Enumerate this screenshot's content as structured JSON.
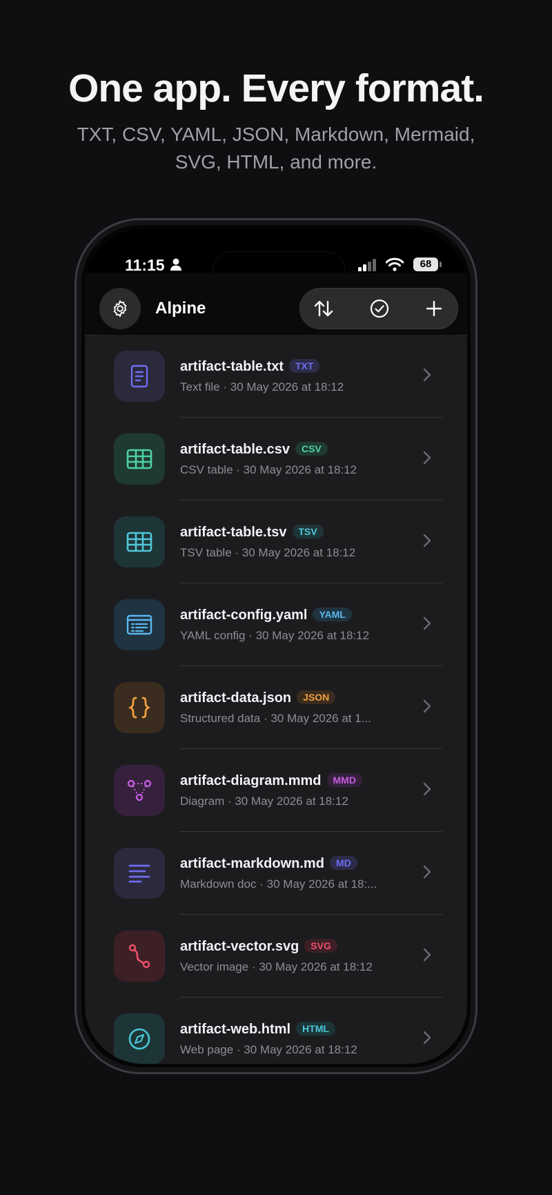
{
  "hero": {
    "headline": "One app. Every format.",
    "subline": "TXT, CSV, YAML, JSON, Markdown, Mermaid, SVG, HTML, and more."
  },
  "status": {
    "time": "11:15",
    "battery": "68"
  },
  "nav": {
    "title": "Alpine"
  },
  "files": [
    {
      "name": "artifact-table.txt",
      "badge": "TXT",
      "meta": "Text file · 30 May 2026 at 18:12",
      "icon": "document-icon",
      "color": "#6f6cf2",
      "tile": "#2a2a3c",
      "badge_bg": "#2d2d4a"
    },
    {
      "name": "artifact-table.csv",
      "badge": "CSV",
      "meta": "CSV table · 30 May 2026 at 18:12",
      "icon": "table-icon",
      "color": "#4fd1a5",
      "tile": "#1f3a33",
      "badge_bg": "#1f3a33"
    },
    {
      "name": "artifact-table.tsv",
      "badge": "TSV",
      "meta": "TSV table · 30 May 2026 at 18:12",
      "icon": "table-icon",
      "color": "#4fc7d8",
      "tile": "#1e3538",
      "badge_bg": "#1e3538"
    },
    {
      "name": "artifact-config.yaml",
      "badge": "YAML",
      "meta": "YAML config · 30 May 2026 at 18:12",
      "icon": "config-icon",
      "color": "#5ab8f0",
      "tile": "#1f3340",
      "badge_bg": "#1f3340"
    },
    {
      "name": "artifact-data.json",
      "badge": "JSON",
      "meta": "Structured data · 30 May 2026 at 1...",
      "icon": "braces-icon",
      "color": "#f0a040",
      "tile": "#3a2c1e",
      "badge_bg": "#3a2c1e"
    },
    {
      "name": "artifact-diagram.mmd",
      "badge": "MMD",
      "meta": "Diagram · 30 May 2026 at 18:12",
      "icon": "diagram-icon",
      "color": "#c45be0",
      "tile": "#35213c",
      "badge_bg": "#35213c"
    },
    {
      "name": "artifact-markdown.md",
      "badge": "MD",
      "meta": "Markdown doc · 30 May 2026 at 18:...",
      "icon": "text-lines-icon",
      "color": "#6f6cf2",
      "tile": "#2a2a3c",
      "badge_bg": "#2d2d4a"
    },
    {
      "name": "artifact-vector.svg",
      "badge": "SVG",
      "meta": "Vector image · 30 May 2026 at 18:12",
      "icon": "vector-path-icon",
      "color": "#f0506a",
      "tile": "#3c2026",
      "badge_bg": "#3c2026"
    },
    {
      "name": "artifact-web.html",
      "badge": "HTML",
      "meta": "Web page · 30 May 2026 at 18:12",
      "icon": "compass-icon",
      "color": "#48c8d8",
      "tile": "#1e3538",
      "badge_bg": "#1e3538"
    }
  ]
}
